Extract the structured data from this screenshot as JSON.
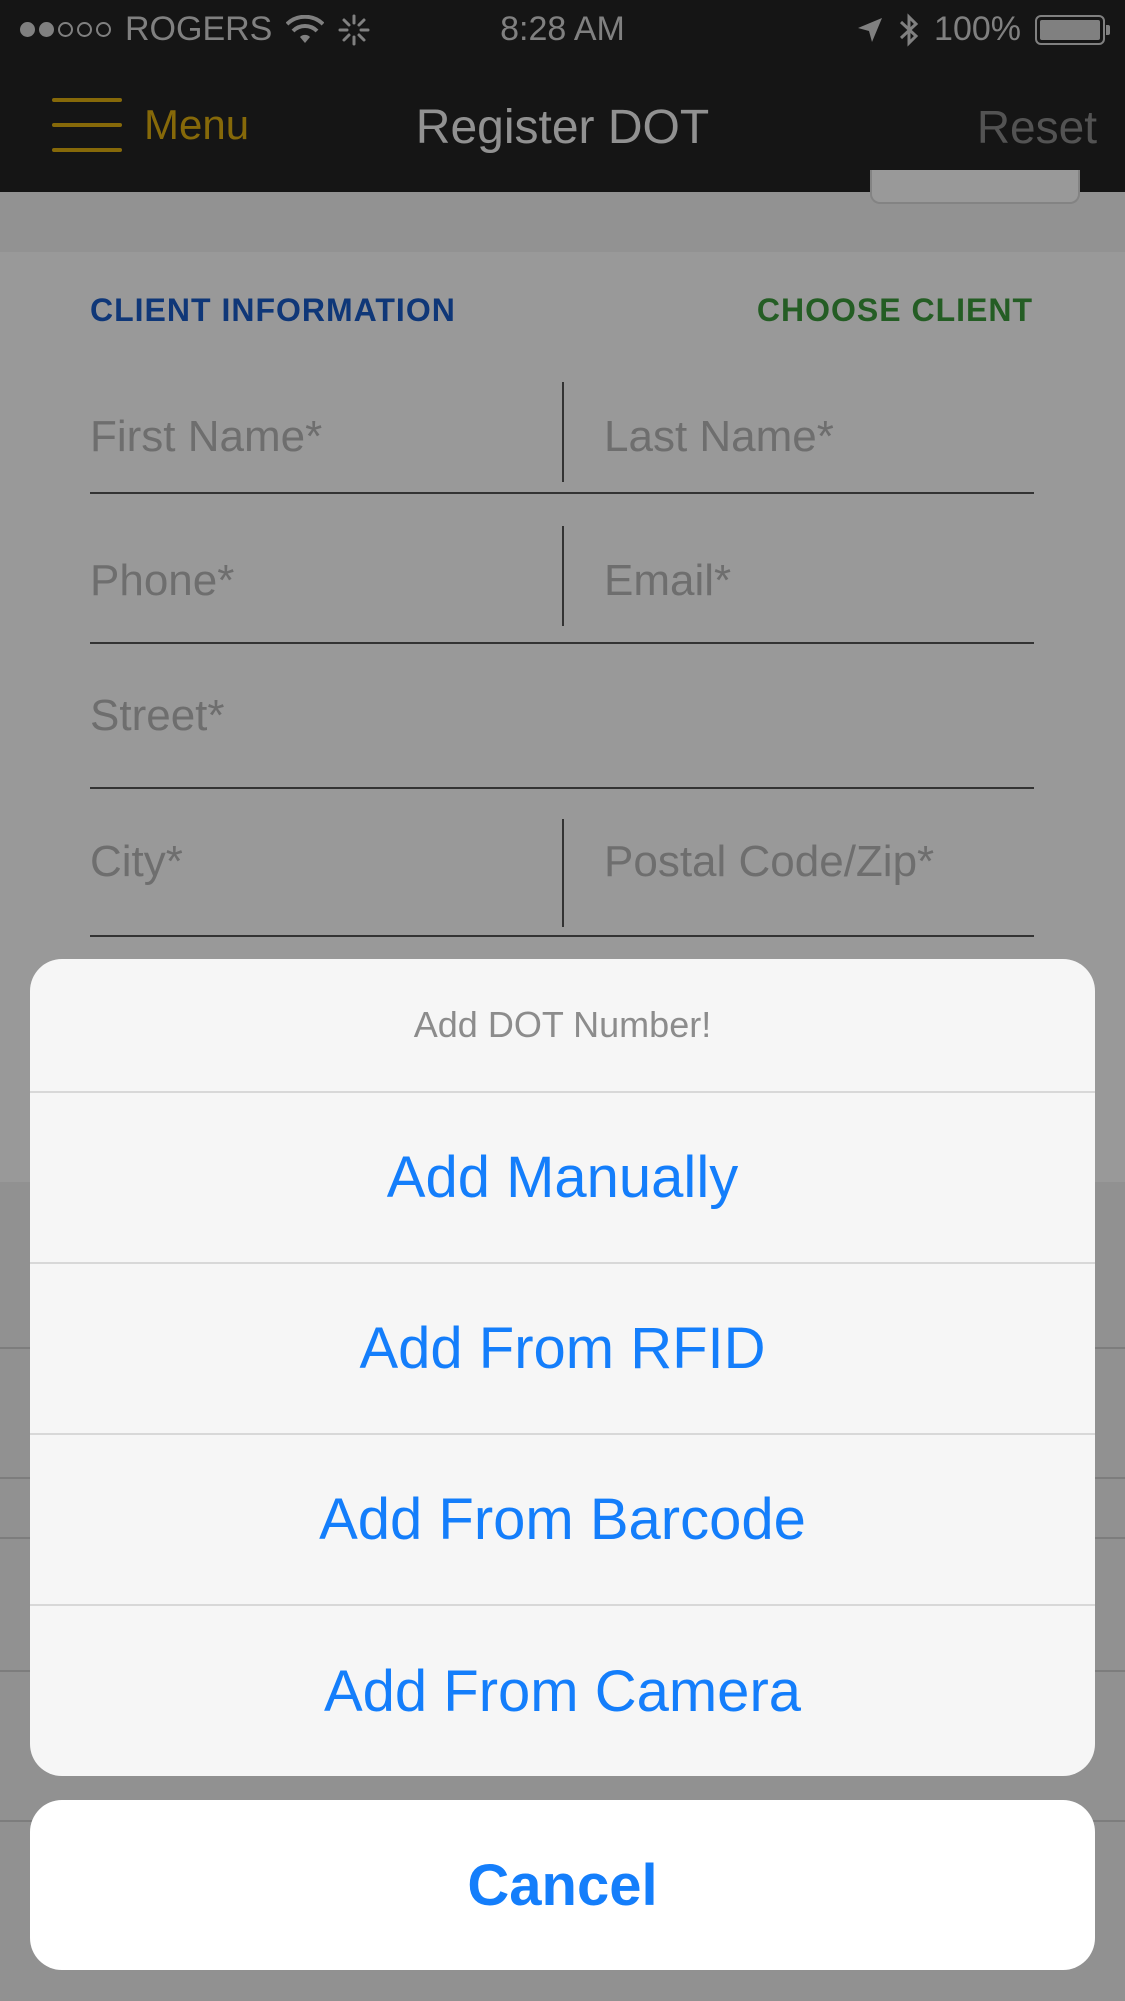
{
  "status_bar": {
    "carrier": "ROGERS",
    "time": "8:28 AM",
    "battery": "100%",
    "icons": [
      "signal-dots-icon",
      "wifi-icon",
      "activity-spinner-icon",
      "location-arrow-icon",
      "bluetooth-icon",
      "battery-icon"
    ]
  },
  "nav": {
    "menu_label": "Menu",
    "title": "Register DOT",
    "reset_label": "Reset"
  },
  "form": {
    "section_title": "CLIENT INFORMATION",
    "choose_client": "CHOOSE CLIENT",
    "fields": {
      "first_name": "First Name*",
      "last_name": "Last Name*",
      "phone": "Phone*",
      "email": "Email*",
      "street": "Street*",
      "city": "City*",
      "postal": "Postal Code/Zip*"
    }
  },
  "action_sheet": {
    "title": "Add DOT Number!",
    "actions": [
      "Add Manually",
      "Add From RFID",
      "Add From Barcode",
      "Add From Camera"
    ],
    "cancel": "Cancel"
  },
  "colors": {
    "nav_bg": "#242424",
    "menu_accent": "#e0b010",
    "section_blue": "#1a5cc8",
    "choose_green": "#3d9b3d",
    "action_blue": "#147efb"
  }
}
